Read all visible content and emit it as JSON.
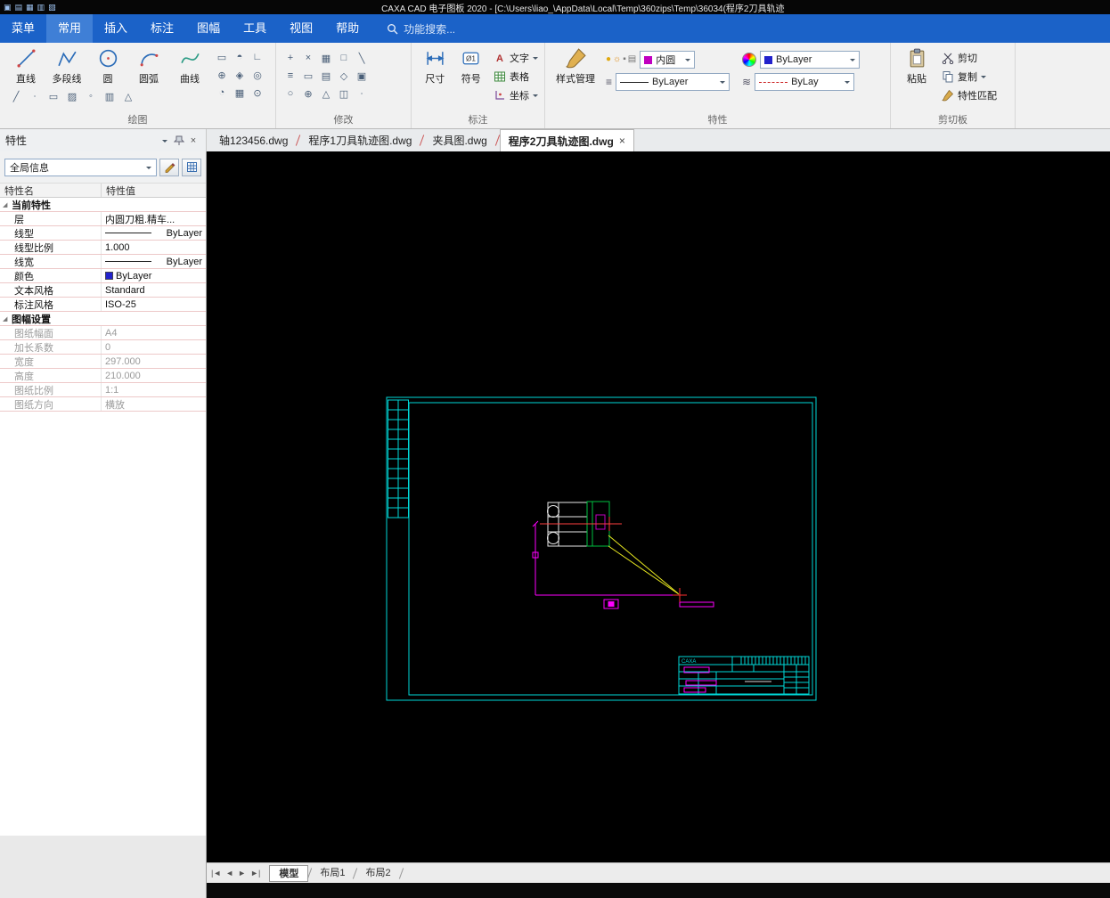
{
  "window": {
    "title": "CAXA CAD 电子图板 2020 - [C:\\Users\\liao_\\AppData\\Local\\Temp\\360zips\\Temp\\36034(程序2刀具轨迹"
  },
  "titlebar": {
    "icons": [
      {
        "name": "app",
        "glyph": "▣"
      },
      {
        "name": "new-file",
        "glyph": "▤"
      },
      {
        "name": "open-file",
        "glyph": "▦"
      },
      {
        "name": "save",
        "glyph": "▥"
      },
      {
        "name": "print",
        "glyph": "▧"
      }
    ]
  },
  "menubar": {
    "tabs": [
      {
        "label": "菜单"
      },
      {
        "label": "常用",
        "active": true
      },
      {
        "label": "插入"
      },
      {
        "label": "标注"
      },
      {
        "label": "图幅"
      },
      {
        "label": "工具"
      },
      {
        "label": "视图"
      },
      {
        "label": "帮助"
      }
    ],
    "search_placeholder": "功能搜索..."
  },
  "ribbon": {
    "groups": [
      {
        "label": "绘图",
        "big_tools": [
          {
            "label": "直线"
          },
          {
            "label": "多段线"
          },
          {
            "label": "圆"
          },
          {
            "label": "圆弧"
          },
          {
            "label": "曲线"
          }
        ],
        "small_icons": [
          "╱",
          "∙",
          "▭",
          "▨",
          "◦",
          "▥",
          "△"
        ],
        "grid_icons": [
          "▭",
          "◓",
          "∟",
          "⊕",
          "◈",
          "◎",
          "◔",
          "▦",
          "⊙"
        ]
      },
      {
        "label": "修改",
        "grid_icons": [
          "+",
          "×",
          "▦",
          "□",
          "╲",
          "≡",
          "▭",
          "▤",
          "◇",
          "▣",
          "○",
          "⊕",
          "△",
          "◫",
          "∙"
        ]
      },
      {
        "label": "标注",
        "big_tools": [
          {
            "label": "尺寸"
          },
          {
            "label": "符号"
          }
        ],
        "menu_tools": [
          {
            "label": "文字"
          },
          {
            "label": "表格"
          },
          {
            "label": "坐标"
          }
        ]
      },
      {
        "label": "特性",
        "big_tools": [
          {
            "label": "样式管理"
          }
        ],
        "layer_value": "内圆",
        "color_value": "ByLayer",
        "linetype_value": "ByLayer",
        "lineweight_value": "ByLay"
      },
      {
        "label": "剪切板",
        "big_tools": [
          {
            "label": "粘贴"
          }
        ],
        "menu_tools": [
          {
            "label": "剪切"
          },
          {
            "label": "复制"
          },
          {
            "label": "特性匹配"
          }
        ]
      }
    ]
  },
  "doc_tabs": [
    {
      "label": "轴123456.dwg"
    },
    {
      "label": "程序1刀具轨迹图.dwg"
    },
    {
      "label": "夹具图.dwg"
    },
    {
      "label": "程序2刀具轨迹图.dwg",
      "active": true,
      "close_glyph": "×"
    }
  ],
  "properties_panel": {
    "title": "特性",
    "close_glyph": "×",
    "selector_value": "全局信息",
    "col_name": "特性名",
    "col_value": "特性值",
    "section_arrow": "◢",
    "sections": [
      {
        "title": "当前特性",
        "rows": [
          {
            "name": "层",
            "value": "内圆刀粗.精车..."
          },
          {
            "name": "线型",
            "value": "ByLayer"
          },
          {
            "name": "线型比例",
            "value": "1.000"
          },
          {
            "name": "线宽",
            "value": "ByLayer"
          },
          {
            "name": "颜色",
            "value": "ByLayer",
            "swatch": "#2222cc"
          },
          {
            "name": "文本风格",
            "value": "Standard"
          },
          {
            "name": "标注风格",
            "value": "ISO-25"
          }
        ]
      },
      {
        "title": "图幅设置",
        "rows": [
          {
            "name": "图纸幅面",
            "value": "A4"
          },
          {
            "name": "加长系数",
            "value": "0"
          },
          {
            "name": "宽度",
            "value": "297.000"
          },
          {
            "name": "高度",
            "value": "210.000"
          },
          {
            "name": "图纸比例",
            "value": "1:1"
          },
          {
            "name": "图纸方向",
            "value": "横放"
          }
        ]
      }
    ]
  },
  "canvas": {
    "title_block_text": "CAXA",
    "colors": {
      "frame": "#00d8d8",
      "dimension": "#ff00ff",
      "toolpath": "#e8e820",
      "outline": "#e8e8e8",
      "aux": "#00c040",
      "marker": "#ff3030"
    }
  },
  "bottom_bar": {
    "nav": [
      "|◄",
      "◄",
      "►",
      "►|"
    ],
    "tabs": [
      {
        "label": "模型",
        "active": true
      },
      {
        "label": "布局1"
      },
      {
        "label": "布局2"
      }
    ]
  },
  "icons": {
    "bulb": "●",
    "sun": "☼",
    "lock": "▪",
    "printer": "▤",
    "linetype": "≡",
    "lineweight": "≋"
  }
}
